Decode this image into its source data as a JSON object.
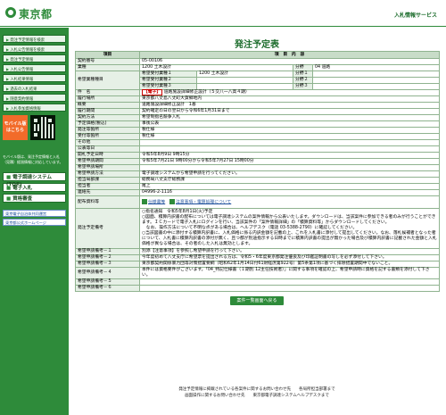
{
  "header": {
    "logo": "東京都",
    "right_title": "入札情報サービス"
  },
  "sidebar": {
    "section1": "",
    "items": [
      "発注予定情報を検索",
      "入札公告情報を検索",
      "発注予定情報",
      "入札公告情報",
      "入札結果情報",
      "過去の入札結果",
      "随意契約情報",
      "入札参加資格情報"
    ],
    "mobile_btn": "モバイル版はこちら",
    "mobile_note": "モバイル版は、発注予定情報と入札（見積）経過情報に対応しています。",
    "section2": "",
    "big_links": [
      "電子調達システム(TOP)",
      "電子入札",
      "資格審査"
    ],
    "section3": "",
    "ext_links": [
      "東京電子自治体共同運営",
      "東京都公式ホームページ"
    ]
  },
  "page": {
    "title": "発注予定表"
  },
  "table": {
    "col_item": "項目",
    "col_content": "項　目　内　容",
    "rows": {
      "contract_no_label": "契約番号",
      "contract_no": "05-00106",
      "business_type_label": "業種",
      "business_type": "1200 土木設計",
      "bunya_label": "分野",
      "bunya": "04 道路",
      "hope_label": "希望業種種目",
      "hope1_label": "希望受付業種１",
      "hope1_val": "1200 土木設計",
      "hope2_label": "希望受付業種２",
      "hope3_label": "希望受付業種３",
      "bunya1": "分野１",
      "bunya2": "分野２",
      "bunya3": "分野３",
      "name_label": "件　名",
      "name_tag": "【電子】",
      "name": "道路施設詳細修正設計（５交八一八高４期）",
      "place_label": "履行場所",
      "place": "東京都八丈島八丈町大賀郷地内",
      "summary_label": "概要",
      "summary": "道路施設詳細修正設計　1基",
      "period_label": "履行期間",
      "period": "契約確定の日の翌日から令和6年1月31日まで",
      "method_label": "契約方法",
      "method": "希望制指名競争入札",
      "price_label": "予定価格(税込)",
      "price": "事後公表",
      "dept_label": "発注等箇所",
      "dept": "税仕様",
      "recv_label": "受付等箇所",
      "recv": "税仕様",
      "other_label": "その他",
      "pubdate_label": "公表等日",
      "open_label": "開札予定日時",
      "open": "令和5年8月9日 9時15分",
      "hope_period_label": "希望申請期間",
      "hope_period": "令和5年7月21日 9時00分から令和5年7月27日 15時00分",
      "hope_recv_label": "希望申請場所",
      "hope_method_label": "希望申請方法",
      "hope_method": "電子調達システムから希望申請を行ってください。",
      "staff_dept_label": "担当局部課",
      "staff_dept": "総務局八丈支庁総務課",
      "staff_label": "担当者",
      "staff": "尾上",
      "tel_label": "連絡先",
      "tel": "04996-2-1116",
      "docs_label": "配布資料等",
      "doc1": "仕様書等",
      "doc2": "注意事項・電算処理について",
      "memo_label": "発注予定備考",
      "memo": "○指名通知　令和5年8月1日(火)予定\n○図面、積算内訳書の配布については電子調達システムの案件情報から公表いたします。ダウンロードは、当該案件に参加できる者のみが行うことができます。ＩＣカードで電子入札にログインを行い、当該案件の「案件情報詳細」の「積算資料等」からダウンロードしてください。\n　なお、操作方法について不明な点がある場合は、ヘルプデスク（電話 03-5388-2790）に確認してください。\n○当該図書の中に添付する積算内訳書に、入札価格に係る内訳金額を記載の上、これを入札書に添付して提出してください。なお、落札候補者となった者について、入札書に積算内訳書の添付が無く、且つ都が別途指示する日時までに積算内訳書の提出が無かった場合及び積算内訳書に記載された金額と入札価格が異なる場合は、その者のした入札は無効とします。",
      "memo1_label": "希望申請備考－１",
      "memo1": "別添【注意事項】を参照し希望申請を行って下さい。",
      "memo2_label": "希望申請備考－２",
      "memo2": "今年度初めて八丈支庁に希望票を提出される方は、令和5・6年度東京都発注優良及び印鑑証明書の写しを必ず添付して下さい。",
      "memo3_label": "希望申請備考－３",
      "memo3": "東京都契約関係暴力団等対策措置要綱（昭和62年1月14日付61財経庶第922号）第5条第1項に基づく排除措置期間中でないこと。",
      "memo4_label": "希望申請備考－４",
      "memo4": "本件には資格要件がございます。「04_特記仕様書（１期別 12主任技術者）」に関する事項を確認の上、希望申請時に資格を記する書類を添付して下さい。",
      "memo5_label": "希望申請備考－５",
      "memo6_label": "希望申請備考－６"
    }
  },
  "back_button": "案件一覧画面へ戻る",
  "footer": {
    "line1": "発注予定情報に掲載されている各案件に関するお問い合わせ先　　各局所担当部署まで",
    "line2": "画面操作に関するお問い合わせ先　　東京都電子調達システムヘルプデスクまで"
  }
}
